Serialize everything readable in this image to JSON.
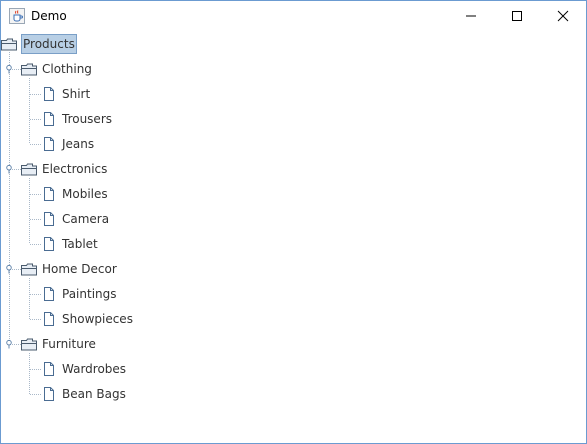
{
  "window": {
    "title": "Demo"
  },
  "tree": {
    "root": {
      "label": "Products",
      "selected": true,
      "icon": "open-folder-icon"
    },
    "categories": [
      {
        "label": "Clothing",
        "icon": "open-folder-icon",
        "expanded": true,
        "children": [
          "Shirt",
          "Trousers",
          "Jeans"
        ]
      },
      {
        "label": "Electronics",
        "icon": "open-folder-icon",
        "expanded": true,
        "children": [
          "Mobiles",
          "Camera",
          "Tablet"
        ]
      },
      {
        "label": "Home Decor",
        "icon": "open-folder-icon",
        "expanded": true,
        "children": [
          "Paintings",
          "Showpieces"
        ]
      },
      {
        "label": "Furniture",
        "icon": "open-folder-icon",
        "expanded": true,
        "children": [
          "Wardrobes",
          "Bean Bags"
        ]
      }
    ]
  },
  "colors": {
    "selection_bg": "#b8cfe5",
    "selection_border": "#7a9fc7",
    "tree_line": "#a9b8c8",
    "window_border": "#6b9bd1"
  }
}
